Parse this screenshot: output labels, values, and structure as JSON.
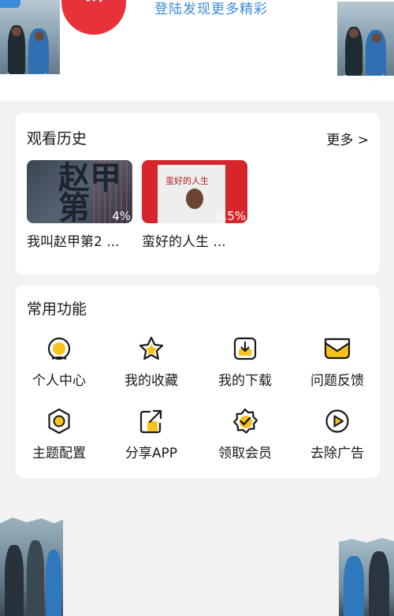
{
  "header": {
    "brand_text": "新",
    "login_tip": "登陆发现更多精彩"
  },
  "history": {
    "title": "观看历史",
    "more_label": "更多 >",
    "items": [
      {
        "label": "我叫赵甲第2 ...",
        "progress": "4%",
        "poster_text": "赵甲第"
      },
      {
        "label": "蛮好的人生 ...",
        "progress": "0.5%",
        "poster_text": "蛮好的人生"
      }
    ]
  },
  "functions": {
    "title": "常用功能",
    "items": [
      {
        "label": "个人中心",
        "icon": "user-center-icon"
      },
      {
        "label": "我的收藏",
        "icon": "star-icon"
      },
      {
        "label": "我的下载",
        "icon": "download-icon"
      },
      {
        "label": "问题反馈",
        "icon": "feedback-mail-icon"
      },
      {
        "label": "主题配置",
        "icon": "theme-hexagon-icon"
      },
      {
        "label": "分享APP",
        "icon": "share-icon"
      },
      {
        "label": "领取会员",
        "icon": "vip-badge-icon"
      },
      {
        "label": "去除广告",
        "icon": "remove-ads-play-icon"
      }
    ]
  },
  "colors": {
    "accent_yellow": "#f7c21b",
    "icon_stroke": "#1a1a1a",
    "brand_red": "#e8323a",
    "link_blue": "#3a8ddb",
    "background": "#f2f2f3",
    "card": "#ffffff"
  }
}
